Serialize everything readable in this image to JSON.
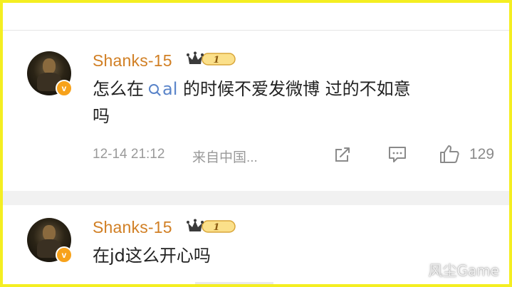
{
  "comments": [
    {
      "username": "Shanks-15",
      "badge_level": "1",
      "text_before": "怎么在",
      "icon_label": "al",
      "text_after": " 的时候不爱发微博 过的不如意",
      "text_wrap": "吗",
      "timestamp": "12-14 21:12",
      "source": "来自中国...",
      "like_count": "129"
    },
    {
      "username": "Shanks-15",
      "badge_level": "1",
      "text": "在jd这么开心吗"
    }
  ],
  "avatar_badge": "v",
  "watermark": "风尘Game",
  "colors": {
    "frame": "#f4ee22",
    "username": "#d17f24",
    "vip_badge": "#f7a21b",
    "meta": "#9a9a9a"
  },
  "icons": [
    "search-icon",
    "share-icon",
    "comment-icon",
    "like-icon",
    "crown-badge-icon"
  ]
}
